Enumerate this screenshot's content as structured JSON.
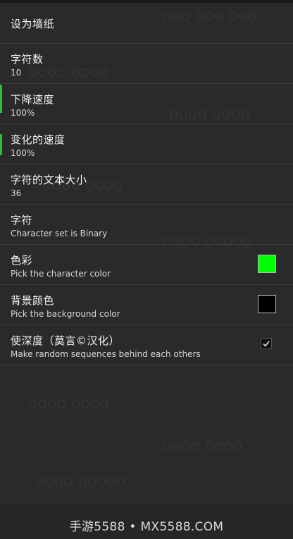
{
  "settings": {
    "items": [
      {
        "title": "设为墙纸",
        "summary": ""
      },
      {
        "title": "字符数",
        "summary": "10"
      },
      {
        "title": "下降速度",
        "summary": "100%"
      },
      {
        "title": "变化的速度",
        "summary": "100%"
      },
      {
        "title": "字符的文本大小",
        "summary": "36"
      },
      {
        "title": "字符",
        "summary": "Character set is Binary"
      },
      {
        "title": "色彩",
        "summary": "Pick the character color",
        "swatch_color": "#00ff00"
      },
      {
        "title": "背景颜色",
        "summary": "Pick the background color",
        "swatch_color": "#000000"
      },
      {
        "title": "使深度（莫言©汉化）",
        "summary": "Make random sequences behind each others",
        "checked": true
      }
    ]
  },
  "footer": {
    "watermark": "手游5588 • MX5588.COM"
  },
  "colors": {
    "background": "#2a2a2a",
    "divider": "#3c3c3c",
    "accent_green": "#00ff00"
  }
}
